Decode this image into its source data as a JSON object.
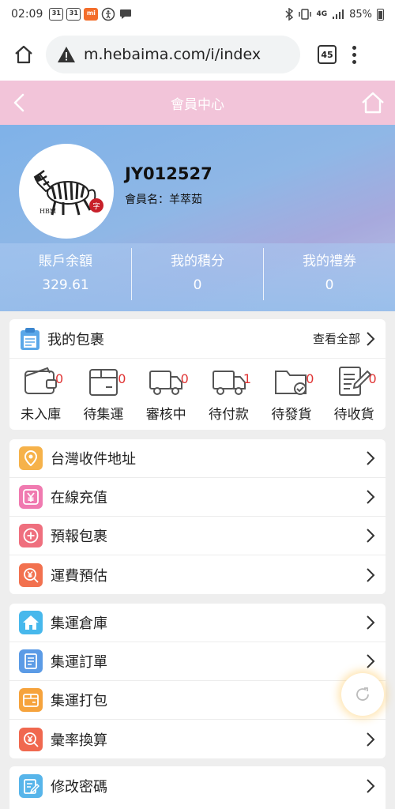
{
  "status": {
    "time": "02:09",
    "icon1": "31",
    "icon2": "31",
    "network": "4G",
    "battery": "85%"
  },
  "browser": {
    "url": "m.hebaima.com/i/index",
    "tabs": "45"
  },
  "header": {
    "title": "會員中心"
  },
  "profile": {
    "username": "JY012527",
    "member_name": "會員名：羊萃茹",
    "logo_text": "HBM",
    "stats": [
      {
        "label": "賬戶余額",
        "value": "329.61"
      },
      {
        "label": "我的積分",
        "value": "0"
      },
      {
        "label": "我的禮券",
        "value": "0"
      }
    ]
  },
  "packages": {
    "title": "我的包裹",
    "view_all": "查看全部",
    "items": [
      {
        "label": "未入庫",
        "count": "0",
        "icon": "wallet-icon"
      },
      {
        "label": "待集運",
        "count": "0",
        "icon": "box-icon"
      },
      {
        "label": "審核中",
        "count": "0",
        "icon": "truck-icon"
      },
      {
        "label": "待付款",
        "count": "1",
        "icon": "truck-icon"
      },
      {
        "label": "待發貨",
        "count": "0",
        "icon": "folder-check-icon"
      },
      {
        "label": "待收貨",
        "count": "0",
        "icon": "edit-doc-icon"
      }
    ]
  },
  "menu1": [
    {
      "label": "台灣收件地址",
      "icon": "location-icon",
      "color": "#f6b24a"
    },
    {
      "label": "在線充值",
      "icon": "yen-icon",
      "color": "#f07ab0"
    },
    {
      "label": "預報包裹",
      "icon": "plus-circle-icon",
      "color": "#ef6f7e"
    },
    {
      "label": "運費預估",
      "icon": "yen-search-icon",
      "color": "#f2714f"
    }
  ],
  "menu2": [
    {
      "label": "集運倉庫",
      "icon": "house-icon",
      "color": "#47b8ec"
    },
    {
      "label": "集運訂單",
      "icon": "document-icon",
      "color": "#5b9be6"
    },
    {
      "label": "集運打包",
      "icon": "package-icon",
      "color": "#f6a33c"
    },
    {
      "label": "彙率換算",
      "icon": "exchange-icon",
      "color": "#f0684f"
    }
  ],
  "menu3": [
    {
      "label": "修改密碼",
      "icon": "edit-password-icon",
      "color": "#57b5ea"
    }
  ]
}
